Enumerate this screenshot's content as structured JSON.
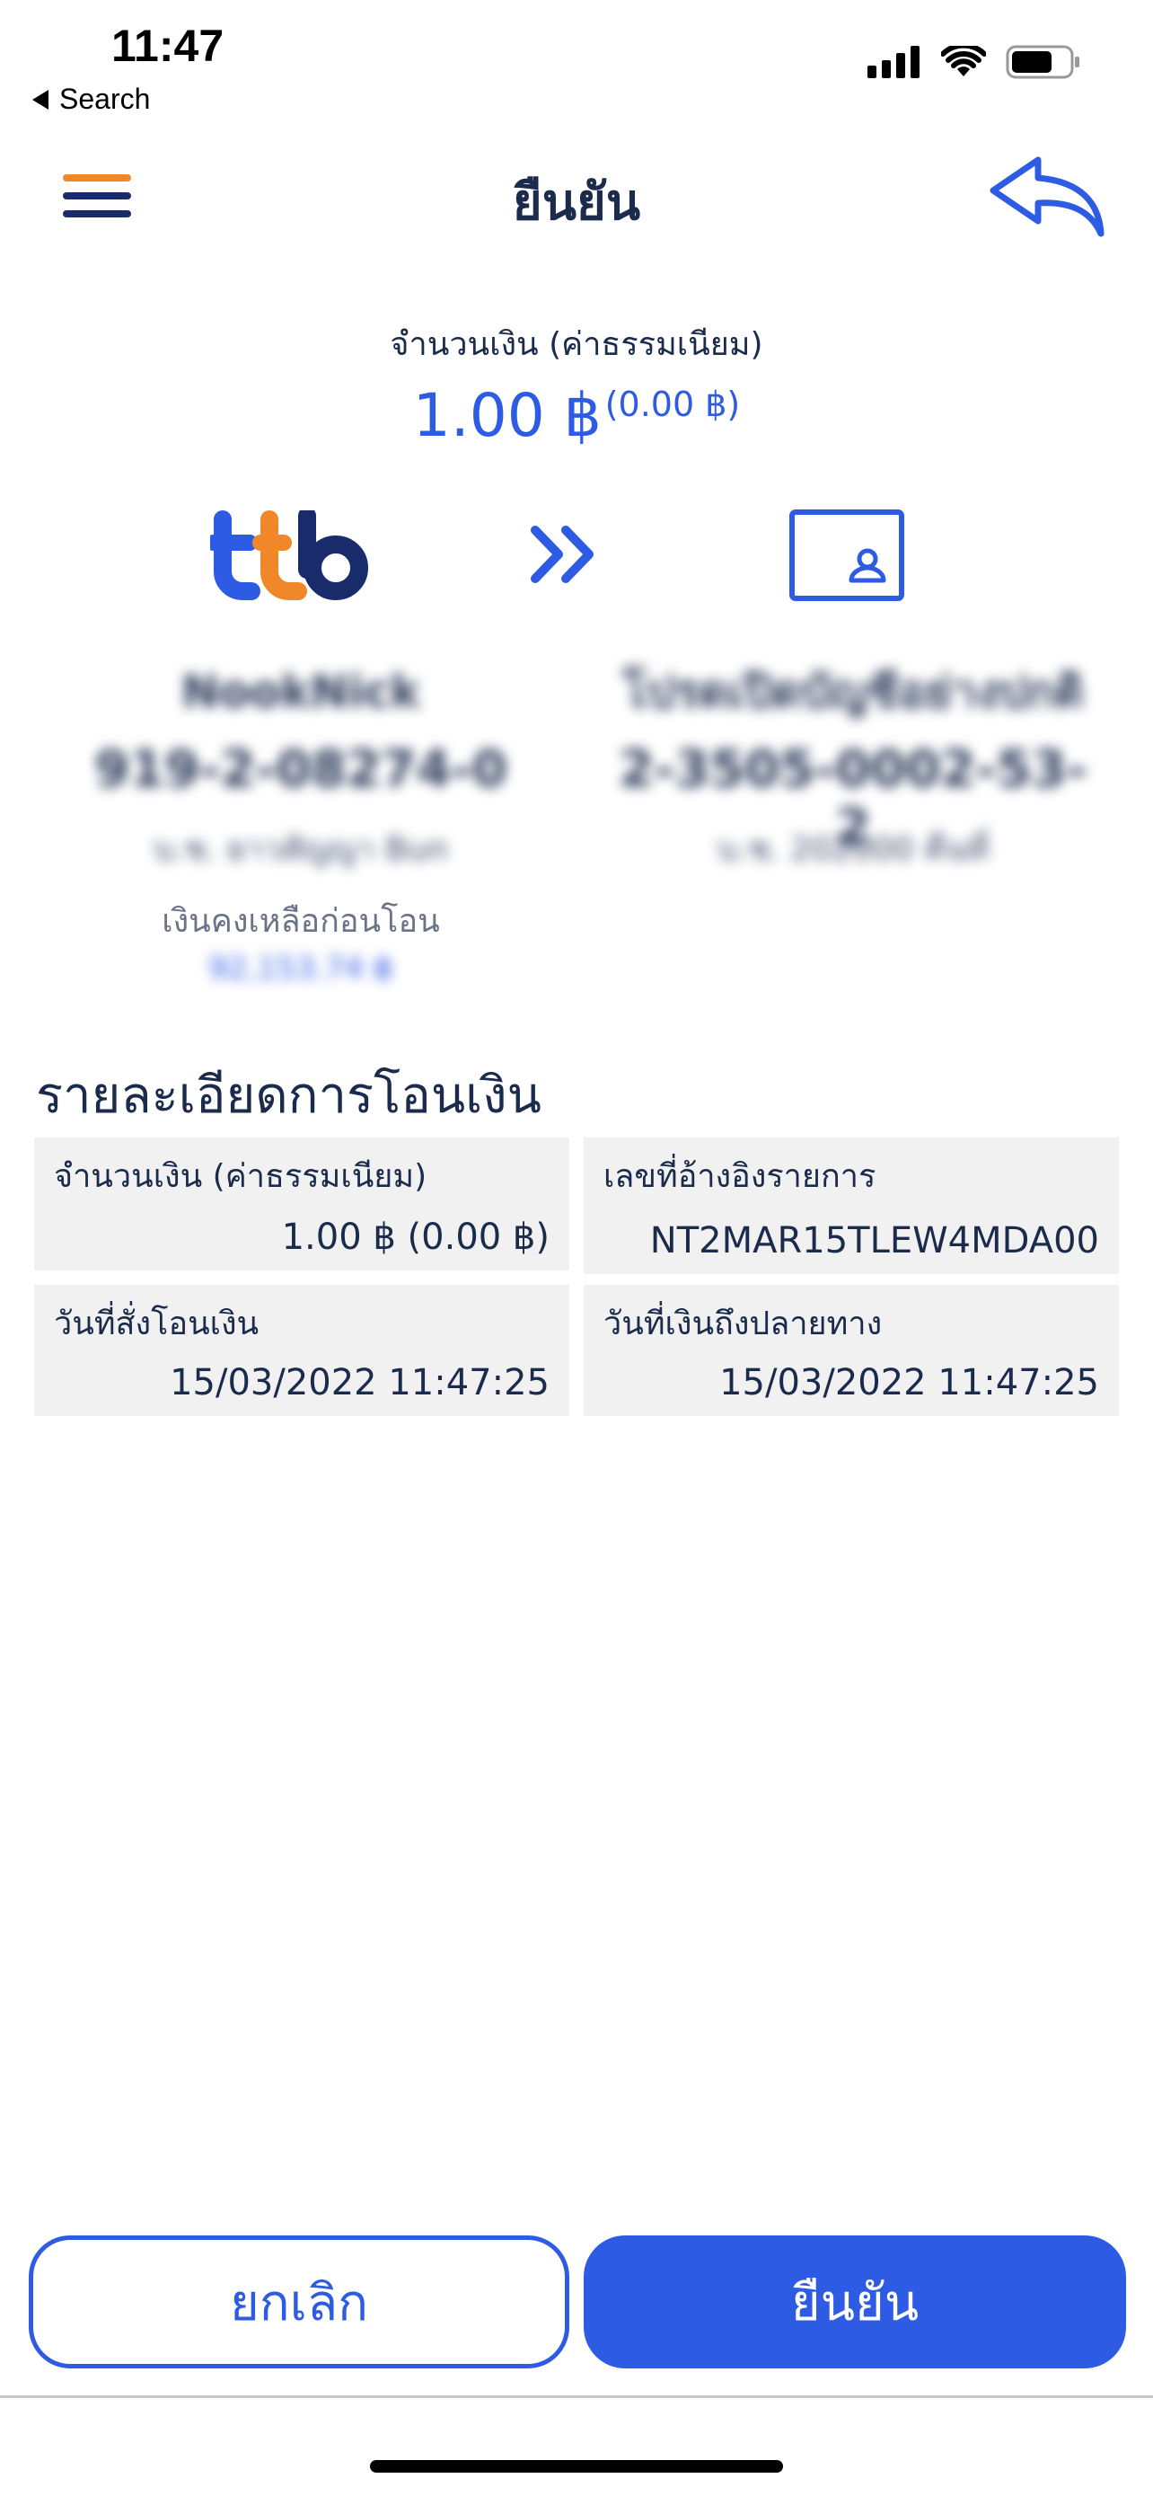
{
  "status_bar": {
    "time": "11:47",
    "back_app_label": "Search",
    "icons": [
      "cellular-signal-icon",
      "wifi-icon",
      "battery-icon"
    ]
  },
  "header": {
    "title": "ยืนยัน",
    "menu_icon": "hamburger-menu-icon",
    "return_icon": "return-arrow-icon"
  },
  "amount": {
    "label": "จำนวนเงิน (ค่าธรรมเนียม)",
    "value": "1.00 ฿",
    "fee": "(0.00 ฿)"
  },
  "from_account": {
    "bank_logo": "ttb",
    "name": "NookNick",
    "number": "919-2-08274-0",
    "bank_name": "บ.ช. ยาวสัญญา Bun",
    "balance_label": "เงินคงเหลือก่อนโอน",
    "balance_value": "92,153.74 ฿"
  },
  "to_account": {
    "name": "โปรดเปิดบัญชีอย่างปกติ",
    "number": "2-3505-0002-53-2",
    "bank_name": "บ.ช. 202000 คืนที่"
  },
  "details": {
    "section_title": "รายละเอียดการโอนเงิน",
    "items": [
      {
        "label": "จำนวนเงิน (ค่าธรรมเนียม)",
        "value": "1.00 ฿ (0.00 ฿)"
      },
      {
        "label": "เลขที่อ้างอิงรายการ",
        "value": "NT2MAR15TLEW4MDA00"
      },
      {
        "label": "วันที่สั่งโอนเงิน",
        "value": "15/03/2022 11:47:25"
      },
      {
        "label": "วันที่เงินถึงปลายทาง",
        "value": "15/03/2022 11:47:25"
      }
    ]
  },
  "buttons": {
    "cancel": "ยกเลิก",
    "confirm": "ยืนยัน"
  },
  "colors": {
    "accent": "#2d5be3",
    "text_dark": "#1a2b4c",
    "menu_orange": "#f0882a",
    "menu_navy": "#1a2b6c",
    "detail_bg": "#f1f1f1"
  }
}
